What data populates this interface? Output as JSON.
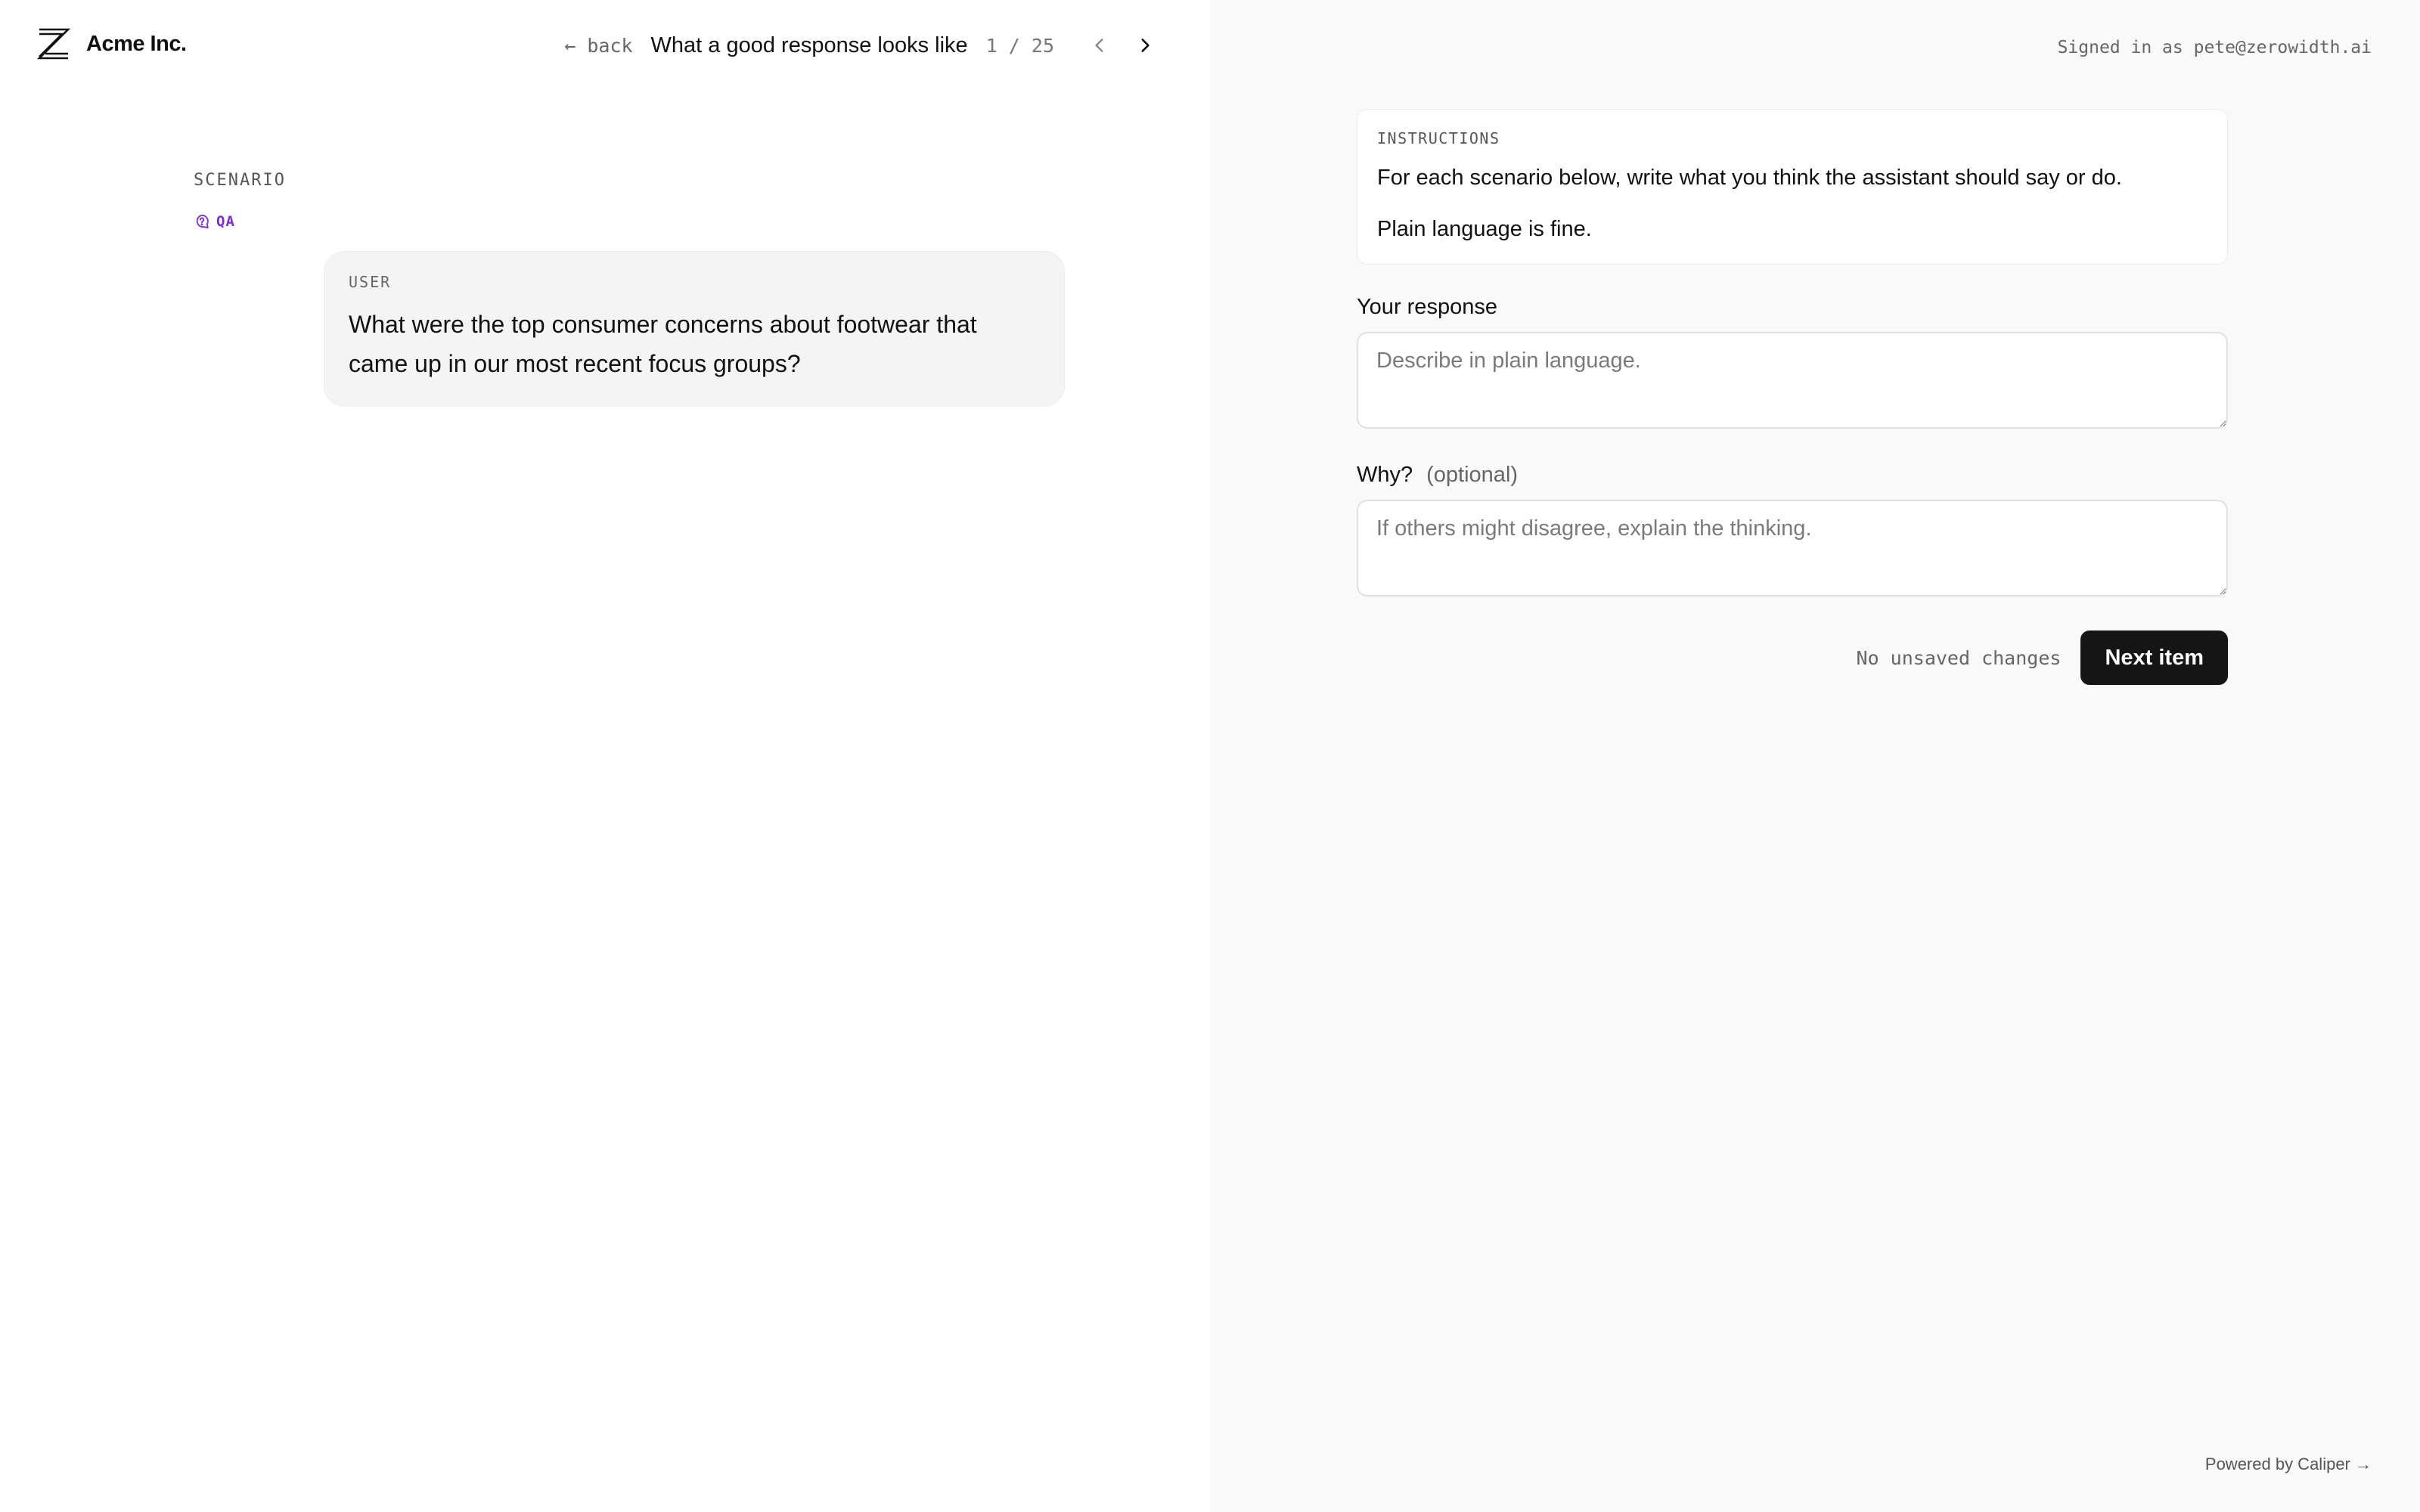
{
  "app": {
    "brand_name": "Acme Inc.",
    "signed_in_text": "Signed in as pete@zerowidth.ai",
    "powered_by": "Powered by Caliper →"
  },
  "nav": {
    "back_label": "← back",
    "title": "What a good response looks like",
    "counter": "1 / 25"
  },
  "scenario": {
    "label": "SCENARIO",
    "tag": "QA",
    "message": {
      "role": "USER",
      "text": "What were the top consumer concerns about footwear that came up in our most recent focus groups?"
    }
  },
  "instructions": {
    "label": "INSTRUCTIONS",
    "lines": [
      "For each scenario below, write what you think the assistant should say or do.",
      "Plain language is fine."
    ]
  },
  "form": {
    "response_label": "Your response",
    "response_value": "",
    "response_placeholder": "Describe in plain language.",
    "why_label": "Why?",
    "why_optional": "(optional)",
    "why_value": "",
    "why_placeholder": "If others might disagree, explain the thinking.",
    "save_status": "No unsaved changes",
    "next_label": "Next item"
  },
  "icons": {
    "logo": "z-logo-icon",
    "prev": "chevron-left-icon",
    "next": "chevron-right-icon",
    "tag": "chat-bubble-icon"
  },
  "colors": {
    "tag_accent": "#7c2bd6",
    "primary_button": "#151515",
    "right_panel_bg": "#f9f9f9"
  }
}
